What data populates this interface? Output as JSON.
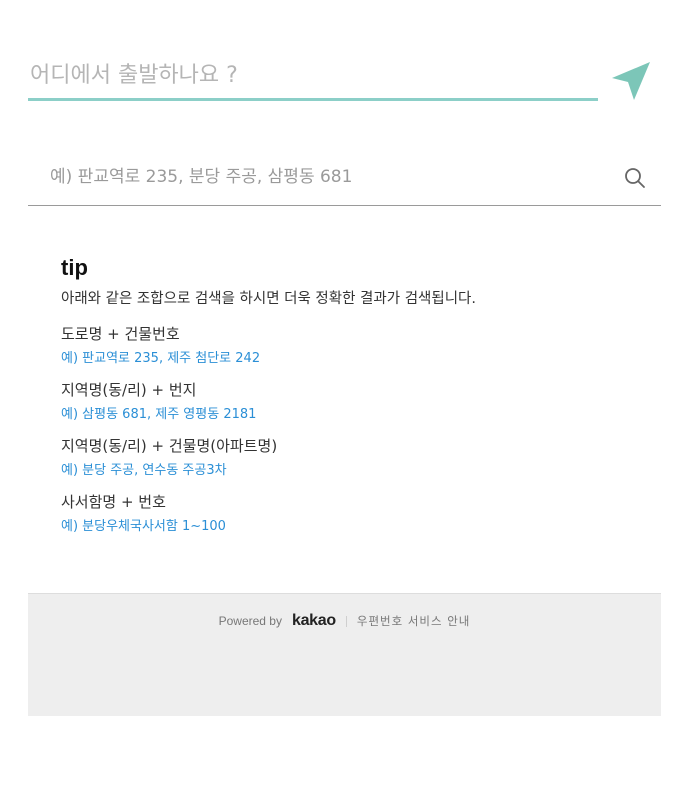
{
  "departure": {
    "placeholder": "어디에서 출발하나요 ?",
    "send_icon": "send-arrow-icon",
    "accent_color": "#7cc6b8"
  },
  "search": {
    "placeholder": "예) 판교역로 235, 분당 주공, 삼평동 681",
    "icon": "search-icon"
  },
  "tip": {
    "title": "tip",
    "description": "아래와 같은 조합으로 검색을 하시면 더욱 정확한 결과가 검색됩니다.",
    "items": [
      {
        "label": "도로명 + 건물번호",
        "example": "예) 판교역로 235,  제주 첨단로 242"
      },
      {
        "label": "지역명(동/리) + 번지",
        "example": "예) 삼평동 681,  제주 영평동 2181"
      },
      {
        "label": "지역명(동/리) + 건물명(아파트명)",
        "example": "예) 분당 주공,  연수동 주공3차"
      },
      {
        "label": "사서함명 + 번호",
        "example": "예) 분당우체국사서함 1~100"
      }
    ],
    "example_color": "#2b8fd6"
  },
  "footer": {
    "powered_by": "Powered by",
    "brand": "kakao",
    "service_link": "우편번호 서비스 안내"
  }
}
